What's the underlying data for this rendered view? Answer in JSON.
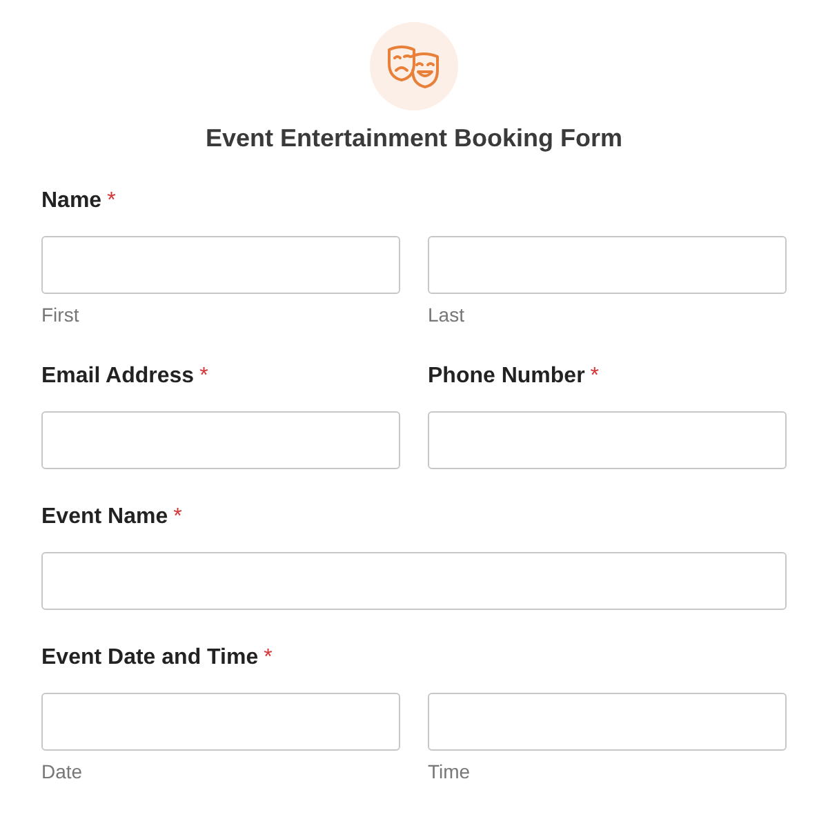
{
  "form": {
    "title": "Event Entertainment Booking Form",
    "rows": [
      {
        "kind": "split",
        "label": "Name",
        "required_mark": "*",
        "inputs": [
          {
            "sublabel": "First"
          },
          {
            "sublabel": "Last"
          }
        ]
      },
      {
        "kind": "pair",
        "fields": [
          {
            "label": "Email Address",
            "required_mark": "*"
          },
          {
            "label": "Phone Number",
            "required_mark": "*"
          }
        ]
      },
      {
        "kind": "single",
        "label": "Event Name",
        "required_mark": "*"
      },
      {
        "kind": "split",
        "label": "Event Date and Time",
        "required_mark": "*",
        "inputs": [
          {
            "sublabel": "Date"
          },
          {
            "sublabel": "Time"
          }
        ]
      }
    ]
  }
}
